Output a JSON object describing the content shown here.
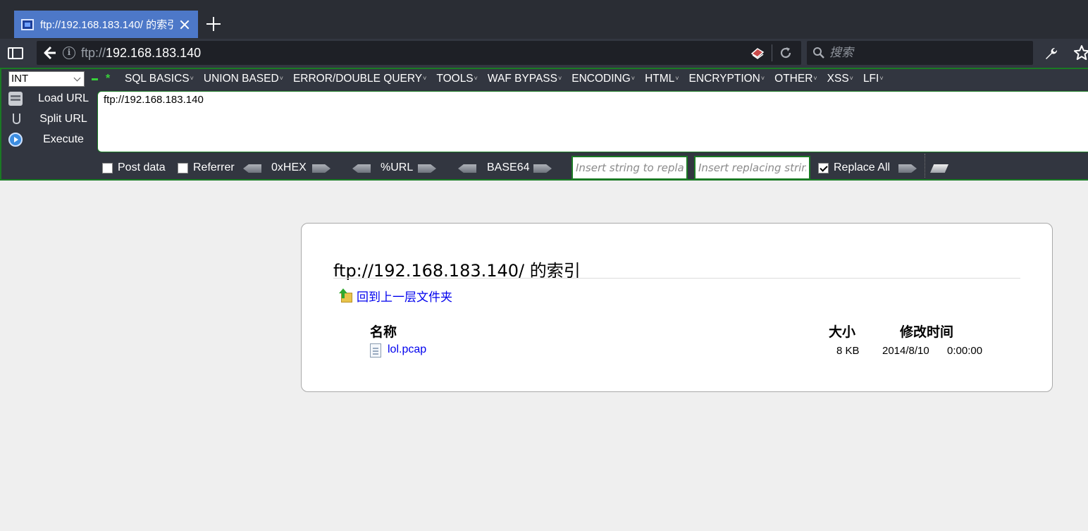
{
  "tab": {
    "title": "ftp://192.168.183.140/ 的索引"
  },
  "navbar": {
    "url_scheme": "ftp://",
    "url_host": "192.168.183.140",
    "search_placeholder": "搜索"
  },
  "hackbar": {
    "select_value": "INT",
    "menu": [
      "SQL BASICS",
      "UNION BASED",
      "ERROR/DOUBLE QUERY",
      "TOOLS",
      "WAF BYPASS",
      "ENCODING",
      "HTML",
      "ENCRYPTION",
      "OTHER",
      "XSS",
      "LFI"
    ],
    "actions": {
      "load": "Load URL",
      "split": "Split URL",
      "execute": "Execute"
    },
    "url_value": "ftp://192.168.183.140",
    "post_data_label": "Post data",
    "referrer_label": "Referrer",
    "hex_label": "0xHEX",
    "url_label": "%URL",
    "base64_label": "BASE64",
    "replace_placeholder": "Insert string to replace",
    "replacing_placeholder": "Insert replacing string",
    "replace_all_label": "Replace All",
    "replace_all_checked": true
  },
  "listing": {
    "title": "ftp://192.168.183.140/ 的索引",
    "up_link": "回到上一层文件夹",
    "columns": {
      "name": "名称",
      "size": "大小",
      "modified": "修改时间"
    },
    "files": [
      {
        "name": "lol.pcap",
        "size": "8 KB",
        "date": "2014/8/10",
        "time": "0:00:00"
      }
    ]
  }
}
